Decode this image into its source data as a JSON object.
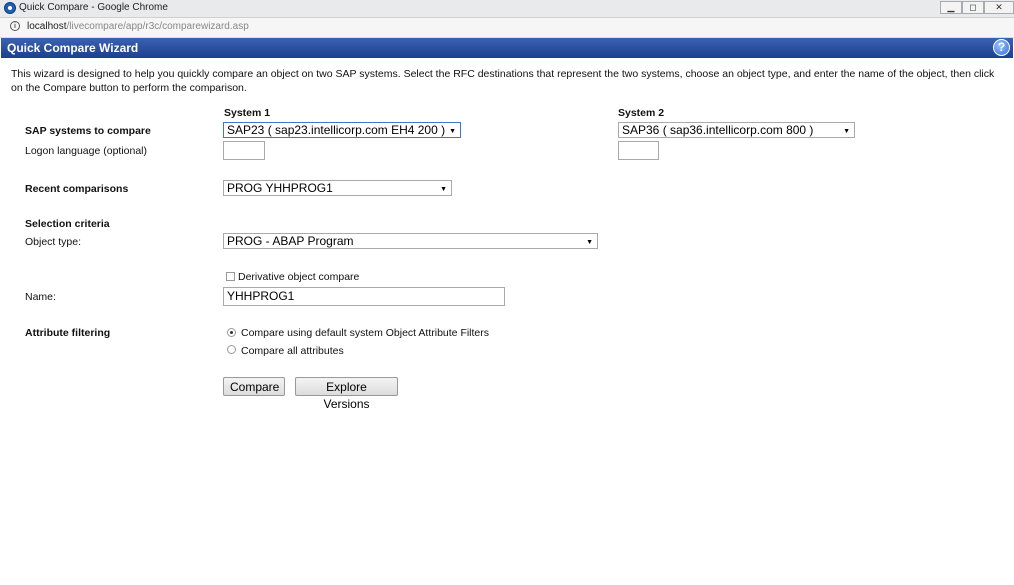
{
  "window": {
    "title": "Quick Compare - Google Chrome",
    "url_host": "localhost",
    "url_path": "/livecompare/app/r3c/comparewizard.asp",
    "controls": {
      "minimize": "▁",
      "restore": "◻",
      "close": "✕"
    }
  },
  "header": {
    "title": "Quick Compare Wizard",
    "help_label": "?"
  },
  "intro": "This wizard is designed to help you quickly compare an object on two SAP systems. Select the RFC destinations that represent the two systems, choose an object type, and enter the name of the object, then click on the Compare button to perform the comparison.",
  "form": {
    "system1_heading": "System 1",
    "system2_heading": "System 2",
    "sap_systems_label": "SAP systems to compare",
    "system1_value": "SAP23 ( sap23.intellicorp.com EH4 200 )",
    "system2_value": "SAP36 ( sap36.intellicorp.com  800 )",
    "logon_label": "Logon language (optional)",
    "logon1_value": "",
    "logon2_value": "",
    "recent_label": "Recent comparisons",
    "recent_value": "PROG YHHPROG1",
    "selection_label": "Selection criteria",
    "object_type_label": "Object type:",
    "object_type_value": "PROG - ABAP Program",
    "derivative_label": "Derivative object compare",
    "derivative_checked": false,
    "name_label": "Name:",
    "name_value": "YHHPROG1",
    "attribute_label": "Attribute filtering",
    "attr_option1": "Compare using default system Object Attribute Filters",
    "attr_option2": "Compare all attributes",
    "attr_selected": "option1"
  },
  "buttons": {
    "compare": "Compare",
    "explore": "Explore Versions"
  },
  "colors": {
    "header_blue": "#1c3f8f",
    "focus_blue": "#3b79d1"
  }
}
